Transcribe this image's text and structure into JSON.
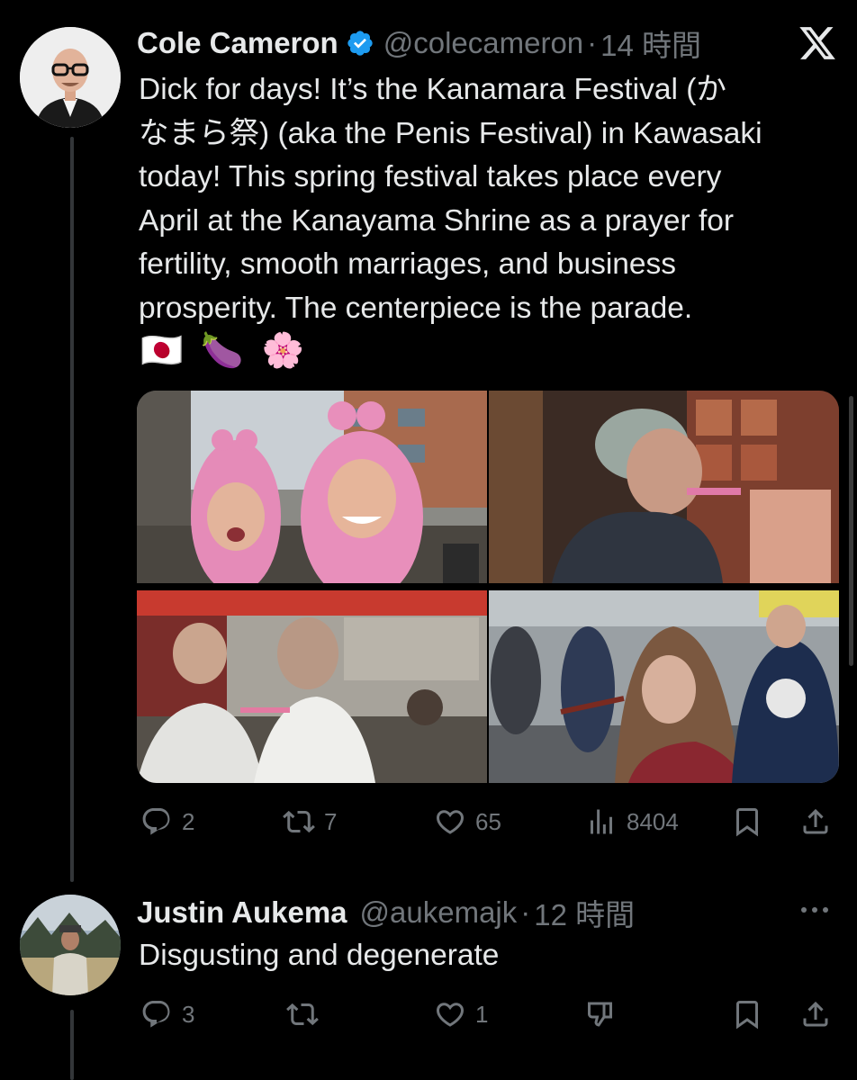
{
  "tweet": {
    "author_name": "Cole Cameron",
    "handle": "@colecameron",
    "separator": "·",
    "time": "14 時間",
    "text_lines": [
      "Dick for days! It’s the Kanamara Festival (か",
      "なまら祭) (aka the Penis Festival) in Kawasaki",
      "today! This spring festival takes place every",
      "April at the Kanayama Shrine as a prayer for",
      "fertility, smooth marriages, and business",
      "prosperity. The centerpiece is the parade."
    ],
    "emojis": [
      "🇯🇵",
      "🍆",
      "🌸"
    ],
    "stats": {
      "replies": "2",
      "reposts": "7",
      "likes": "65",
      "views": "8404"
    }
  },
  "reply": {
    "author_name": "Justin Aukema",
    "handle": "@aukemajk",
    "separator": "·",
    "time": "12 時間",
    "text": "Disgusting and degenerate",
    "stats": {
      "replies": "3",
      "likes": "1"
    }
  },
  "icons": {
    "more": "more-icon",
    "close": "x-logo-icon"
  }
}
